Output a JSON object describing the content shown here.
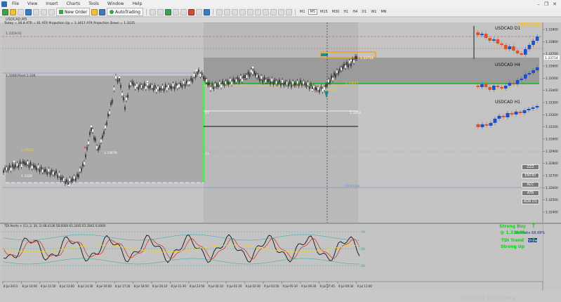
{
  "window": {
    "menu": [
      "File",
      "View",
      "Insert",
      "Charts",
      "Tools",
      "Window",
      "Help"
    ],
    "controls": [
      "–",
      "❐",
      "✕"
    ]
  },
  "toolbar": {
    "new_order_label": "New Order",
    "autotrading_label": "AutoTrading",
    "timeframes": [
      "M1",
      "M5",
      "M15",
      "M30",
      "H1",
      "H4",
      "D1",
      "W1",
      "MN"
    ],
    "active_timeframe": "M5"
  },
  "chart_header": {
    "symbol_line": "USDCAD,M5",
    "info_line": "Today = 26.8    ATR = 81    ATR Projection Up = 1.3417    ATR Projection Down = 1.3335"
  },
  "chart": {
    "symbol_watermark": "USDCAD",
    "level_left_top": "1.3359 R1",
    "level_left_mid": "1.3348 Pivot 1.336",
    "level_bubble_1": "1.33528",
    "level_bubble_2": "1.33679",
    "level_bubble_3": "1.3328",
    "cursor_label": "1.33714",
    "box_right_label": "1.33636",
    "yellow_label": "1.33617",
    "green_box_label": "1.3361",
    "open_label": "1.3353",
    "rl_label": "R1",
    "mid_label": "S1",
    "first_line_label": "First Line",
    "x_ticks": [
      "8 Jul 2013",
      "8 Jul 10:00",
      "8 Jul 11:50",
      "8 Jul 13:00",
      "8 Jul 14:30",
      "8 Jul 16:00",
      "8 Jul 17:20",
      "8 Jul 18:50",
      "8 Jul 20:10",
      "8 Jul 21:30",
      "8 Jul 22:50",
      "9 Jul 00:10",
      "9 Jul 01:20",
      "9 Jul 02:30",
      "9 Jul 03:50",
      "9 Jul 05:10",
      "9 Jul 06:30",
      "9 Jul 07:45",
      "9 Jul 09:30",
      "9 Jul 11:00"
    ],
    "y_ticks": [
      "1.33900",
      "1.33800",
      "1.33700",
      "1.33600",
      "1.33500",
      "1.33400",
      "1.33300",
      "1.33200",
      "1.33100",
      "1.33000",
      "1.32900",
      "1.32800",
      "1.32700",
      "1.32600",
      "1.32500",
      "1.32400"
    ],
    "current_price": "1.33714"
  },
  "mini_charts": {
    "d1_label": "USDCAD D1",
    "h4_label": "USDCAD H4",
    "h1_label": "USDCAD H1",
    "symbol_big": "USDCAD"
  },
  "indicator": {
    "header": "TDI Alerts + (13, 2, 34, 2)  68.4136  58.6000  61.2445  61.3042  0.0000",
    "levels": [
      "70",
      "50",
      "32"
    ]
  },
  "side_panel": {
    "buttons": [
      "ZZZ",
      "ENTRY",
      "ACC",
      "ATR",
      "ADR D1"
    ],
    "bid_ratio": "Bid Ratio 68.68%",
    "show_label": "Show",
    "signal_1": "Strong Buy",
    "signal_1_price": "@ 1.33644",
    "signal_2": "TDI Trend",
    "signal_2b": "Strong Up"
  },
  "os_watermark": "Activate Windows",
  "colors": {
    "chart_bg": "#c6c6c6",
    "green": "#0bd40b",
    "red_line": "#d23a2a",
    "bull_candle": "#1f4fc8",
    "bear_candle": "#e0502d",
    "orange_box": "#f0a020"
  }
}
